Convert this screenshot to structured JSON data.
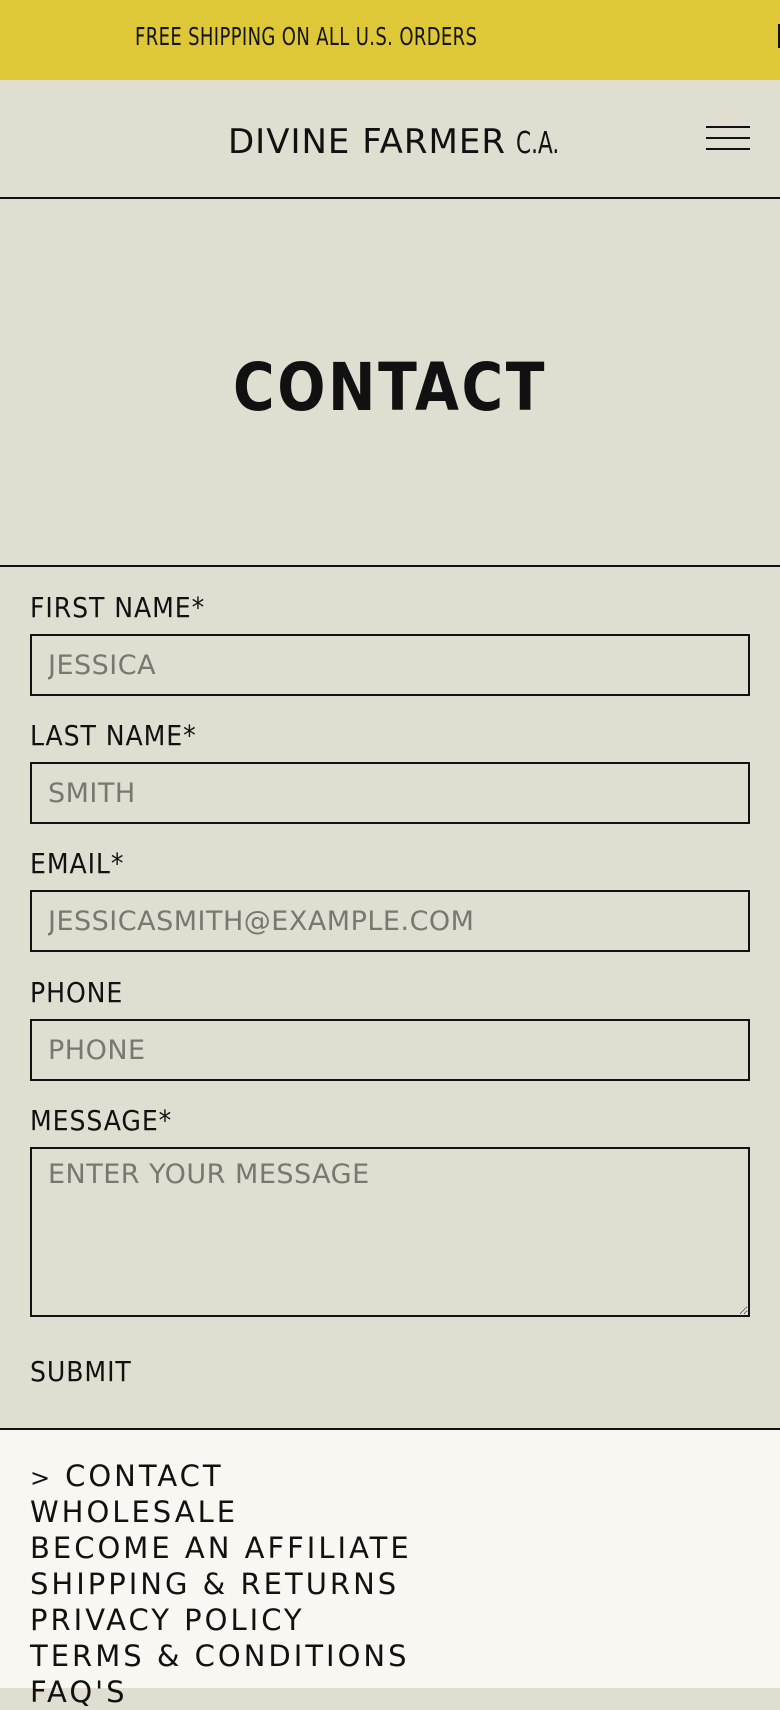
{
  "announcement": {
    "text": "FREE SHIPPING ON ALL U.S. ORDERS"
  },
  "header": {
    "brand_main": "DIVINE FARMER",
    "brand_sub": "C.A.",
    "menu_icon": "hamburger-menu-icon"
  },
  "hero": {
    "title": "CONTACT"
  },
  "form": {
    "first_name": {
      "label": "FIRST NAME*",
      "placeholder": "JESSICA",
      "value": ""
    },
    "last_name": {
      "label": "LAST NAME*",
      "placeholder": "SMITH",
      "value": ""
    },
    "email": {
      "label": "EMAIL*",
      "placeholder": "JESSICASMITH@EXAMPLE.COM",
      "value": ""
    },
    "phone": {
      "label": "PHONE",
      "placeholder": "PHONE",
      "value": ""
    },
    "message": {
      "label": "MESSAGE*",
      "placeholder": "ENTER YOUR MESSAGE",
      "value": ""
    },
    "submit_label": "SUBMIT"
  },
  "footer": {
    "active_marker": ">",
    "links": [
      "CONTACT",
      "WHOLESALE",
      "BECOME AN AFFILIATE",
      "SHIPPING & RETURNS",
      "PRIVACY POLICY",
      "TERMS & CONDITIONS",
      "FAQ'S"
    ]
  },
  "colors": {
    "announcement_bg": "#dfc838",
    "page_bg": "#dfded1",
    "footer_bg": "#f8f7f1",
    "text": "#111111",
    "placeholder": "#787770"
  }
}
